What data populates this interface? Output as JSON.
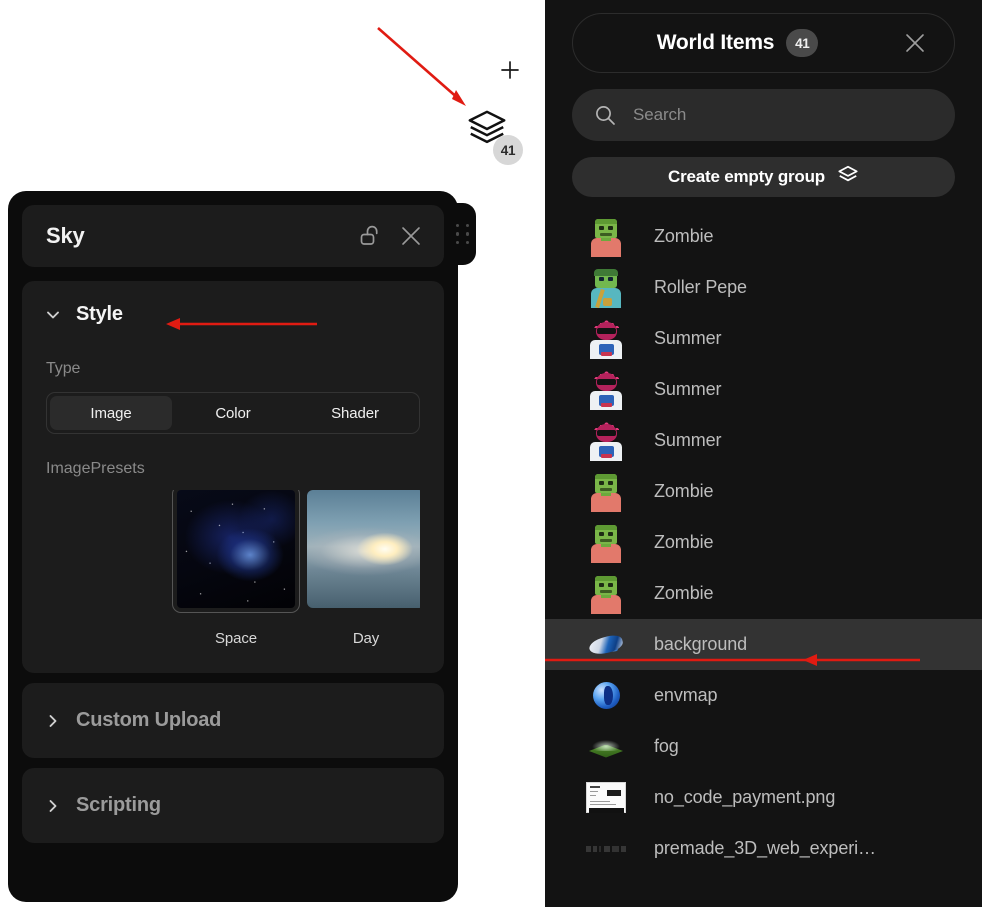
{
  "canvas": {
    "add_icon": "plus-icon",
    "layers_icon": "layers-icon",
    "layers_badge": "41"
  },
  "sky_panel": {
    "title": "Sky",
    "lock_icon": "unlock-icon",
    "close_icon": "close-icon",
    "drag_handle_icon": "drag-handle-icon",
    "sections": {
      "style": {
        "title": "Style",
        "expanded": true,
        "chevron_icon": "chevron-down-icon",
        "type_label": "Type",
        "type_options": [
          "Image",
          "Color",
          "Shader"
        ],
        "type_selected": "Image",
        "presets_label": "ImagePresets",
        "presets": [
          {
            "name": "Space",
            "selected": true,
            "thumb": "thumb-space"
          },
          {
            "name": "Day",
            "selected": false,
            "thumb": "thumb-day"
          },
          {
            "name": "",
            "selected": false,
            "thumb": "thumb-night"
          }
        ]
      },
      "custom_upload": {
        "title": "Custom Upload",
        "expanded": false,
        "chevron_icon": "chevron-right-icon"
      },
      "scripting": {
        "title": "Scripting",
        "expanded": false,
        "chevron_icon": "chevron-right-icon"
      }
    }
  },
  "world_panel": {
    "title": "World Items",
    "count": "41",
    "close_icon": "close-icon",
    "search": {
      "placeholder": "Search",
      "value": "",
      "icon": "search-icon"
    },
    "create_group": {
      "label": "Create empty group",
      "icon": "layers-icon"
    },
    "items": [
      {
        "label": "Zombie",
        "thumb": "zombie",
        "selected": false
      },
      {
        "label": "Roller Pepe",
        "thumb": "pepe",
        "selected": false
      },
      {
        "label": "Summer",
        "thumb": "summer",
        "selected": false
      },
      {
        "label": "Summer",
        "thumb": "summer",
        "selected": false
      },
      {
        "label": "Summer",
        "thumb": "summer",
        "selected": false
      },
      {
        "label": "Zombie",
        "thumb": "zombie",
        "selected": false
      },
      {
        "label": "Zombie",
        "thumb": "zombie",
        "selected": false
      },
      {
        "label": "Zombie",
        "thumb": "zombie",
        "selected": false
      },
      {
        "label": "background",
        "thumb": "ship",
        "selected": true
      },
      {
        "label": "envmap",
        "thumb": "globe",
        "selected": false
      },
      {
        "label": "fog",
        "thumb": "fog",
        "selected": false
      },
      {
        "label": "no_code_payment.png",
        "thumb": "doc",
        "selected": false
      },
      {
        "label": "premade_3D_web_experi…",
        "thumb": "faint",
        "selected": false
      }
    ]
  },
  "annotations": {
    "arrow_color": "#e01b12",
    "arrows": [
      {
        "name": "arrow-to-layers-button"
      },
      {
        "name": "arrow-to-style-section"
      },
      {
        "name": "arrow-to-background-item"
      }
    ]
  }
}
